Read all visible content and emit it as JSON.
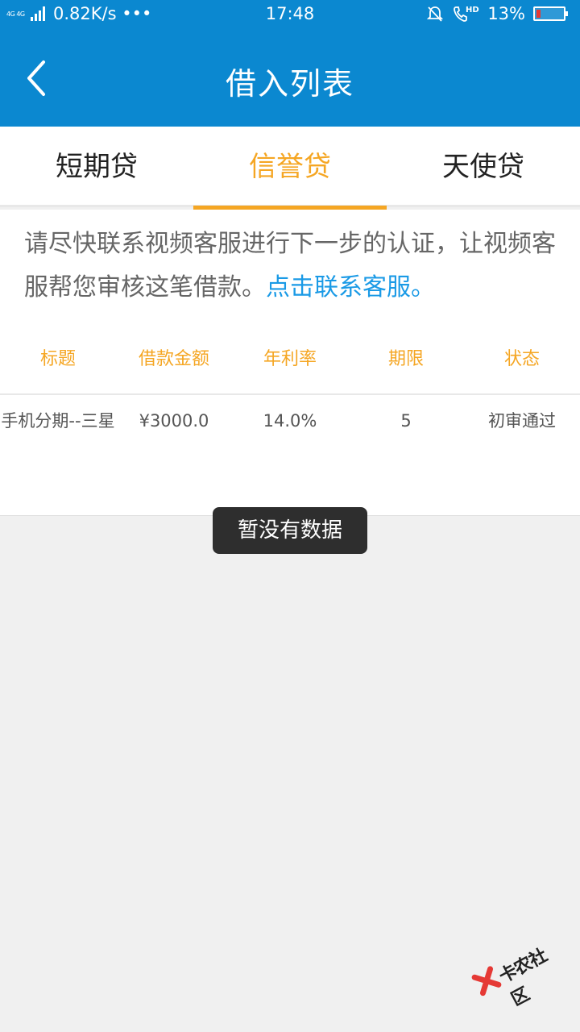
{
  "status_bar": {
    "network": "4G 4G",
    "speed": "0.82K/s •••",
    "time": "17:48",
    "battery": "13%",
    "hd": "HD"
  },
  "header": {
    "title": "借入列表"
  },
  "tabs": [
    {
      "label": "短期贷",
      "active": false
    },
    {
      "label": "信誉贷",
      "active": true
    },
    {
      "label": "天使贷",
      "active": false
    }
  ],
  "notice": {
    "text": "请尽快联系视频客服进行下一步的认证，让视频客服帮您审核这笔借款。",
    "link": "点击联系客服。"
  },
  "table": {
    "headers": [
      "标题",
      "借款金额",
      "年利率",
      "期限",
      "状态"
    ],
    "rows": [
      [
        "手机分期--三星",
        "¥3000.0",
        "14.0%",
        "5",
        "初审通过"
      ]
    ]
  },
  "toast": "暂没有数据",
  "watermark": "卡农社区",
  "colors": {
    "header_bg": "#0b88d0",
    "accent": "#f5a623",
    "link": "#1a9ae6"
  }
}
